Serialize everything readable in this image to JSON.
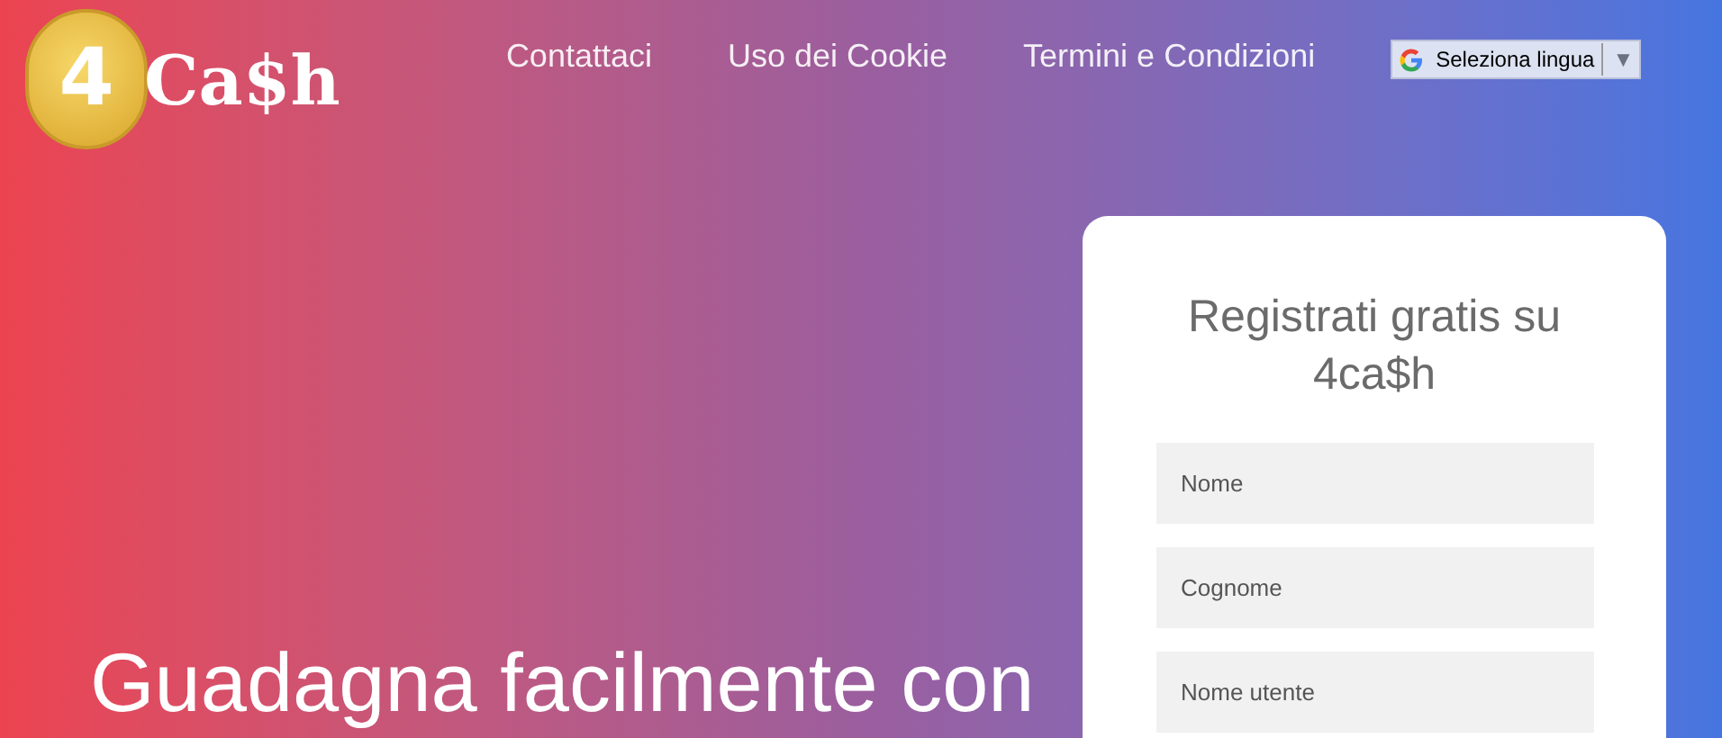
{
  "logo": {
    "coin_text": "4",
    "text": "Ca$h"
  },
  "nav": [
    {
      "label": "Contattaci"
    },
    {
      "label": "Uso dei Cookie"
    },
    {
      "label": "Termini e Condizioni"
    }
  ],
  "language_select": {
    "label": "Seleziona lingua",
    "arrow": "▼"
  },
  "hero": {
    "headline": "Guadagna facilmente con"
  },
  "signup": {
    "title": "Registrati gratis su 4ca$h",
    "fields": [
      {
        "placeholder": "Nome"
      },
      {
        "placeholder": "Cognome"
      },
      {
        "placeholder": "Nome utente"
      }
    ]
  }
}
